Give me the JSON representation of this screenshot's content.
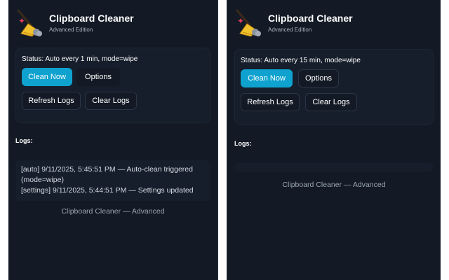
{
  "app": {
    "title": "Clipboard Cleaner",
    "subtitle": "Advanced Edition",
    "footer": "Clipboard Cleaner — Advanced"
  },
  "colors": {
    "background": "#131a25",
    "card": "#161e2b",
    "primary_button": "#0fa2cf",
    "text": "#ffffff"
  },
  "left": {
    "status": "Status: Auto every 1 min, mode=wipe",
    "buttons": {
      "clean_now": "Clean Now",
      "options": "Options",
      "refresh_logs": "Refresh Logs",
      "clear_logs": "Clear Logs"
    },
    "logs_heading": "Logs:",
    "logs": [
      "[auto] 9/11/2025, 5:45:51 PM — Auto-clean triggered",
      "(mode=wipe)",
      "[settings] 9/11/2025, 5:44:51 PM — Settings updated"
    ]
  },
  "right": {
    "status": "Status: Auto every 15 min, mode=wipe",
    "buttons": {
      "clean_now": "Clean Now",
      "options": "Options",
      "refresh_logs": "Refresh Logs",
      "clear_logs": "Clear Logs"
    },
    "logs_heading": "Logs:",
    "logs": []
  },
  "icons": {
    "logo": "broom-icon"
  }
}
